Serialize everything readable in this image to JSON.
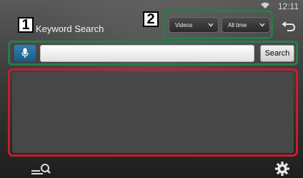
{
  "status": {
    "time": "12:11"
  },
  "header": {
    "title": "Keyword Search"
  },
  "callouts": {
    "one": "1",
    "two": "2"
  },
  "filters": {
    "type_selected": "Videos",
    "period_selected": "All time"
  },
  "search": {
    "query": "",
    "button_label": "Search"
  },
  "colors": {
    "callout_frame_green": "#2a7a4c",
    "results_frame_red": "#c81e28",
    "mic_blue": "#1f6ea0"
  },
  "icons": [
    "wifi-icon",
    "back-icon",
    "chevron-down-icon",
    "microphone-icon",
    "search-menu-icon",
    "gear-icon"
  ]
}
